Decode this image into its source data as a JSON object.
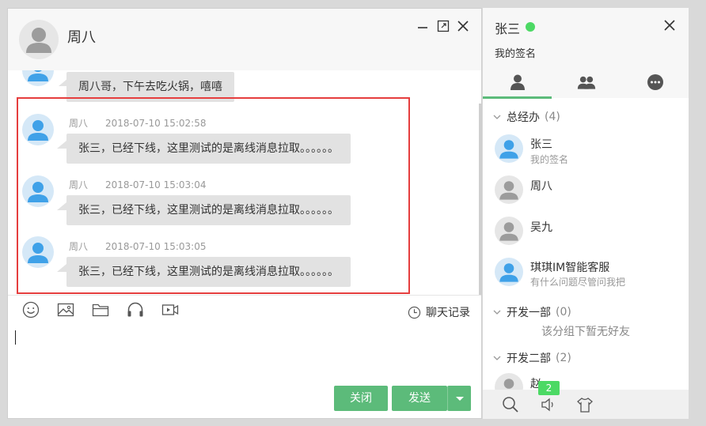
{
  "chat": {
    "title": "周八",
    "messages": [
      {
        "text": "周八哥，下午去吃火锅，嘻嘻"
      },
      {
        "sender": "周八",
        "time": "2018-07-10 15:02:58",
        "text": "张三，已经下线，这里测试的是离线消息拉取。。。。。。"
      },
      {
        "sender": "周八",
        "time": "2018-07-10 15:03:04",
        "text": "张三，已经下线，这里测试的是离线消息拉取。。。。。。"
      },
      {
        "sender": "周八",
        "time": "2018-07-10 15:03:05",
        "text": "张三，已经下线，这里测试的是离线消息拉取。。。。。。"
      }
    ],
    "toolbar": {
      "icons": [
        "emoji-icon",
        "image-icon",
        "folder-icon",
        "headset-icon",
        "video-icon"
      ],
      "history_label": "聊天记录"
    },
    "input_value": "",
    "close_label": "关闭",
    "send_label": "发送"
  },
  "panel": {
    "user_name": "张三",
    "status_color": "#4cd964",
    "signature": "我的签名",
    "tabs": [
      "user-icon",
      "group-icon",
      "chat-icon"
    ],
    "active_tab": 0,
    "groups": [
      {
        "name": "总经办",
        "count": "(4)",
        "contacts": [
          {
            "name": "张三",
            "sign": "我的签名",
            "online": true
          },
          {
            "name": "周八",
            "sign": "",
            "online": false
          },
          {
            "name": "吴九",
            "sign": "",
            "online": false
          },
          {
            "name": "琪琪IM智能客服",
            "sign": "有什么问题尽管问我把",
            "online": true
          }
        ]
      },
      {
        "name": "开发一部",
        "count": "(0)",
        "empty_note": "该分组下暂无好友"
      },
      {
        "name": "开发二部",
        "count": "(2)",
        "contacts": [
          {
            "name": "赵",
            "sign": "",
            "online": false
          }
        ]
      }
    ],
    "bottom_icons": [
      "search-icon",
      "speaker-icon",
      "shirt-icon"
    ],
    "badge": "2"
  },
  "colors": {
    "accent": "#5cbb7a",
    "highlight": "#e53e3e",
    "online": "#4cd964",
    "bubble": "#e2e2e2"
  }
}
